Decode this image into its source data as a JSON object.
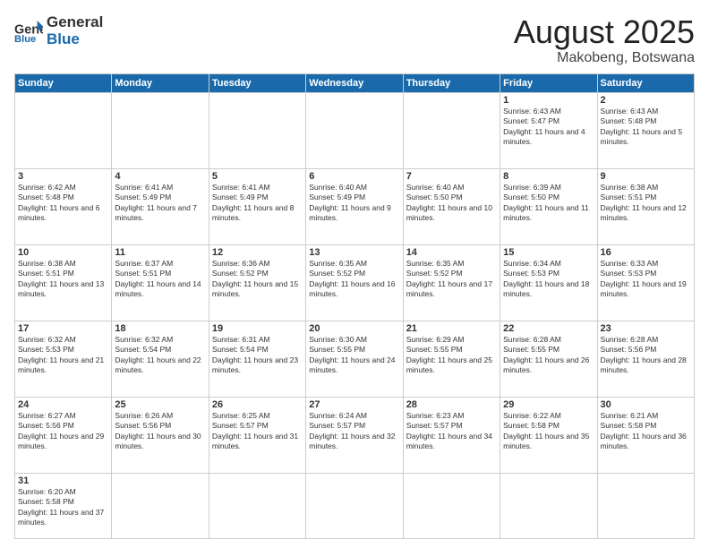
{
  "header": {
    "logo_general": "General",
    "logo_blue": "Blue",
    "month_title": "August 2025",
    "location": "Makobeng, Botswana"
  },
  "days_of_week": [
    "Sunday",
    "Monday",
    "Tuesday",
    "Wednesday",
    "Thursday",
    "Friday",
    "Saturday"
  ],
  "weeks": [
    [
      {
        "day": "",
        "info": ""
      },
      {
        "day": "",
        "info": ""
      },
      {
        "day": "",
        "info": ""
      },
      {
        "day": "",
        "info": ""
      },
      {
        "day": "",
        "info": ""
      },
      {
        "day": "1",
        "info": "Sunrise: 6:43 AM\nSunset: 5:47 PM\nDaylight: 11 hours and 4 minutes."
      },
      {
        "day": "2",
        "info": "Sunrise: 6:43 AM\nSunset: 5:48 PM\nDaylight: 11 hours and 5 minutes."
      }
    ],
    [
      {
        "day": "3",
        "info": "Sunrise: 6:42 AM\nSunset: 5:48 PM\nDaylight: 11 hours and 6 minutes."
      },
      {
        "day": "4",
        "info": "Sunrise: 6:41 AM\nSunset: 5:49 PM\nDaylight: 11 hours and 7 minutes."
      },
      {
        "day": "5",
        "info": "Sunrise: 6:41 AM\nSunset: 5:49 PM\nDaylight: 11 hours and 8 minutes."
      },
      {
        "day": "6",
        "info": "Sunrise: 6:40 AM\nSunset: 5:49 PM\nDaylight: 11 hours and 9 minutes."
      },
      {
        "day": "7",
        "info": "Sunrise: 6:40 AM\nSunset: 5:50 PM\nDaylight: 11 hours and 10 minutes."
      },
      {
        "day": "8",
        "info": "Sunrise: 6:39 AM\nSunset: 5:50 PM\nDaylight: 11 hours and 11 minutes."
      },
      {
        "day": "9",
        "info": "Sunrise: 6:38 AM\nSunset: 5:51 PM\nDaylight: 11 hours and 12 minutes."
      }
    ],
    [
      {
        "day": "10",
        "info": "Sunrise: 6:38 AM\nSunset: 5:51 PM\nDaylight: 11 hours and 13 minutes."
      },
      {
        "day": "11",
        "info": "Sunrise: 6:37 AM\nSunset: 5:51 PM\nDaylight: 11 hours and 14 minutes."
      },
      {
        "day": "12",
        "info": "Sunrise: 6:36 AM\nSunset: 5:52 PM\nDaylight: 11 hours and 15 minutes."
      },
      {
        "day": "13",
        "info": "Sunrise: 6:35 AM\nSunset: 5:52 PM\nDaylight: 11 hours and 16 minutes."
      },
      {
        "day": "14",
        "info": "Sunrise: 6:35 AM\nSunset: 5:52 PM\nDaylight: 11 hours and 17 minutes."
      },
      {
        "day": "15",
        "info": "Sunrise: 6:34 AM\nSunset: 5:53 PM\nDaylight: 11 hours and 18 minutes."
      },
      {
        "day": "16",
        "info": "Sunrise: 6:33 AM\nSunset: 5:53 PM\nDaylight: 11 hours and 19 minutes."
      }
    ],
    [
      {
        "day": "17",
        "info": "Sunrise: 6:32 AM\nSunset: 5:53 PM\nDaylight: 11 hours and 21 minutes."
      },
      {
        "day": "18",
        "info": "Sunrise: 6:32 AM\nSunset: 5:54 PM\nDaylight: 11 hours and 22 minutes."
      },
      {
        "day": "19",
        "info": "Sunrise: 6:31 AM\nSunset: 5:54 PM\nDaylight: 11 hours and 23 minutes."
      },
      {
        "day": "20",
        "info": "Sunrise: 6:30 AM\nSunset: 5:55 PM\nDaylight: 11 hours and 24 minutes."
      },
      {
        "day": "21",
        "info": "Sunrise: 6:29 AM\nSunset: 5:55 PM\nDaylight: 11 hours and 25 minutes."
      },
      {
        "day": "22",
        "info": "Sunrise: 6:28 AM\nSunset: 5:55 PM\nDaylight: 11 hours and 26 minutes."
      },
      {
        "day": "23",
        "info": "Sunrise: 6:28 AM\nSunset: 5:56 PM\nDaylight: 11 hours and 28 minutes."
      }
    ],
    [
      {
        "day": "24",
        "info": "Sunrise: 6:27 AM\nSunset: 5:56 PM\nDaylight: 11 hours and 29 minutes."
      },
      {
        "day": "25",
        "info": "Sunrise: 6:26 AM\nSunset: 5:56 PM\nDaylight: 11 hours and 30 minutes."
      },
      {
        "day": "26",
        "info": "Sunrise: 6:25 AM\nSunset: 5:57 PM\nDaylight: 11 hours and 31 minutes."
      },
      {
        "day": "27",
        "info": "Sunrise: 6:24 AM\nSunset: 5:57 PM\nDaylight: 11 hours and 32 minutes."
      },
      {
        "day": "28",
        "info": "Sunrise: 6:23 AM\nSunset: 5:57 PM\nDaylight: 11 hours and 34 minutes."
      },
      {
        "day": "29",
        "info": "Sunrise: 6:22 AM\nSunset: 5:58 PM\nDaylight: 11 hours and 35 minutes."
      },
      {
        "day": "30",
        "info": "Sunrise: 6:21 AM\nSunset: 5:58 PM\nDaylight: 11 hours and 36 minutes."
      }
    ],
    [
      {
        "day": "31",
        "info": "Sunrise: 6:20 AM\nSunset: 5:58 PM\nDaylight: 11 hours and 37 minutes."
      },
      {
        "day": "",
        "info": ""
      },
      {
        "day": "",
        "info": ""
      },
      {
        "day": "",
        "info": ""
      },
      {
        "day": "",
        "info": ""
      },
      {
        "day": "",
        "info": ""
      },
      {
        "day": "",
        "info": ""
      }
    ]
  ]
}
